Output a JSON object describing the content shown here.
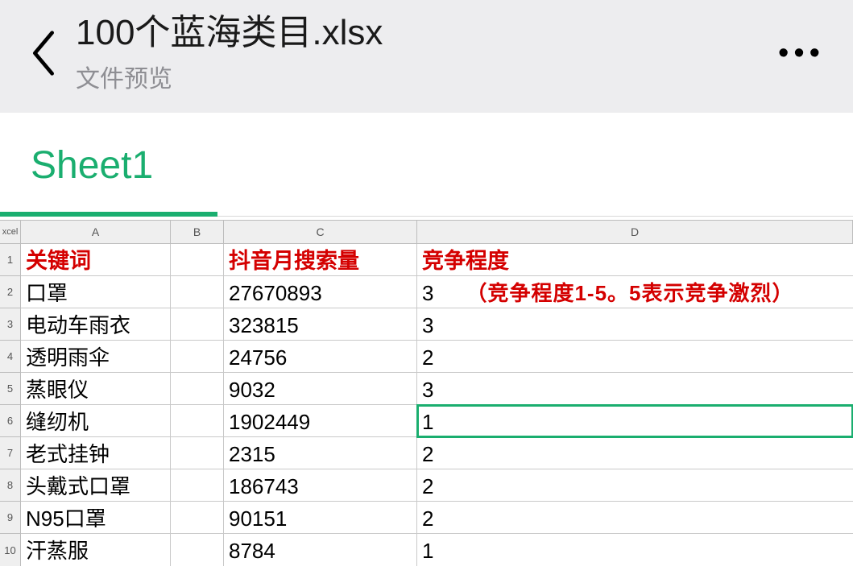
{
  "header": {
    "title": "100个蓝海类目.xlsx",
    "subtitle": "文件预览"
  },
  "tab": {
    "active": "Sheet1"
  },
  "columns": {
    "corner": "xcel",
    "a": "A",
    "b": "B",
    "c": "C",
    "d": "D"
  },
  "header_row": {
    "a": "关键词",
    "c": "抖音月搜索量",
    "d": "竞争程度"
  },
  "note": "（竞争程度1-5。5表示竞争激烈）",
  "rows": [
    {
      "n": "2",
      "a": "口罩",
      "c": "27670893",
      "d": "3",
      "withNote": true
    },
    {
      "n": "3",
      "a": "电动车雨衣",
      "c": "323815",
      "d": "3"
    },
    {
      "n": "4",
      "a": "透明雨伞",
      "c": "24756",
      "d": "2"
    },
    {
      "n": "5",
      "a": "蒸眼仪",
      "c": "9032",
      "d": "3"
    },
    {
      "n": "6",
      "a": "缝纫机",
      "c": "1902449",
      "d": "1",
      "selected": true
    },
    {
      "n": "7",
      "a": "老式挂钟",
      "c": "2315",
      "d": "2"
    },
    {
      "n": "8",
      "a": "头戴式口罩",
      "c": "186743",
      "d": "2"
    },
    {
      "n": "9",
      "a": "N95口罩",
      "c": "90151",
      "d": "2"
    },
    {
      "n": "10",
      "a": "汗蒸服",
      "c": "8784",
      "d": "1"
    }
  ],
  "chart_data": {
    "type": "table",
    "columns": [
      "关键词",
      "抖音月搜索量",
      "竞争程度"
    ],
    "rows": [
      [
        "口罩",
        27670893,
        3
      ],
      [
        "电动车雨衣",
        323815,
        3
      ],
      [
        "透明雨伞",
        24756,
        2
      ],
      [
        "蒸眼仪",
        9032,
        3
      ],
      [
        "缝纫机",
        1902449,
        1
      ],
      [
        "老式挂钟",
        2315,
        2
      ],
      [
        "头戴式口罩",
        186743,
        2
      ],
      [
        "N95口罩",
        90151,
        2
      ],
      [
        "汗蒸服",
        8784,
        1
      ]
    ],
    "note": "（竞争程度1-5。5表示竞争激烈）"
  }
}
